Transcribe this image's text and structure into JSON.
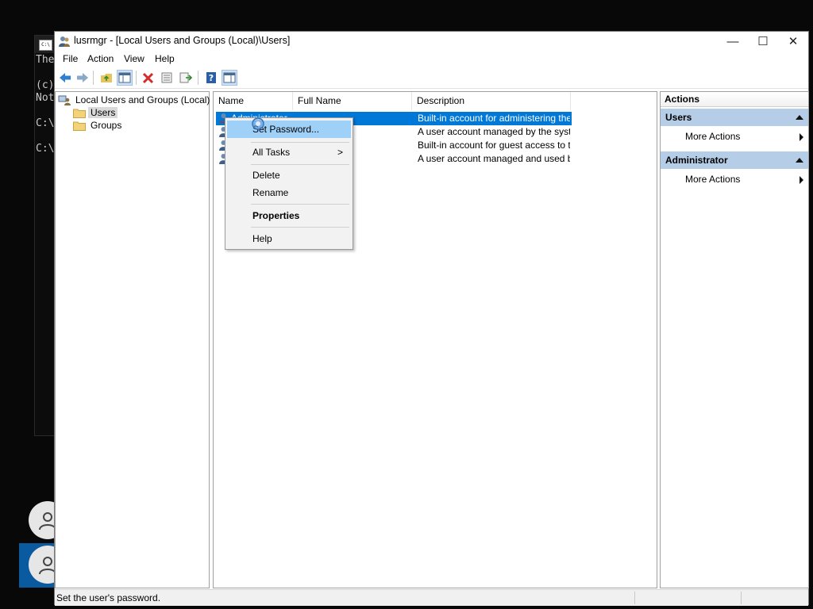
{
  "console": {
    "lines": [
      "The",
      "(c)",
      "Not",
      "C:\\",
      "C:\\"
    ]
  },
  "window": {
    "title": "lusrmgr - [Local Users and Groups (Local)\\Users]",
    "buttons": {
      "minimize": "—",
      "maximize": "☐",
      "close": "✕"
    }
  },
  "menu": [
    "File",
    "Action",
    "View",
    "Help"
  ],
  "tree": {
    "root": "Local Users and Groups (Local)",
    "children": [
      "Users",
      "Groups"
    ]
  },
  "list": {
    "columns": [
      "Name",
      "Full Name",
      "Description"
    ],
    "rows": [
      {
        "name": "Administrator",
        "full_name": "",
        "description": "Built-in account for administering the c..."
      },
      {
        "name": "",
        "full_name": "",
        "description": "A user account managed by the syste..."
      },
      {
        "name": "",
        "full_name": "",
        "description": "Built-in account for guest access to th..."
      },
      {
        "name": "",
        "full_name": "",
        "description": "A user account managed and used b..."
      }
    ]
  },
  "context_menu": {
    "items": [
      {
        "label": "Set Password...",
        "highlighted": true
      },
      {
        "label": "All Tasks",
        "submenu": ">"
      },
      {
        "label": "Delete"
      },
      {
        "label": "Rename"
      },
      {
        "label": "Properties",
        "bold": true
      },
      {
        "label": "Help"
      }
    ]
  },
  "actions": {
    "title": "Actions",
    "sections": [
      {
        "header": "Users",
        "item": "More Actions"
      },
      {
        "header": "Administrator",
        "item": "More Actions"
      }
    ]
  },
  "status": {
    "text": "Set the user's password."
  },
  "colors": {
    "selection": "#0078d7",
    "context_highlight": "#9fd0f7",
    "actions_header": "#b5cde6",
    "user_tile_selected": "#0a5aa0"
  }
}
